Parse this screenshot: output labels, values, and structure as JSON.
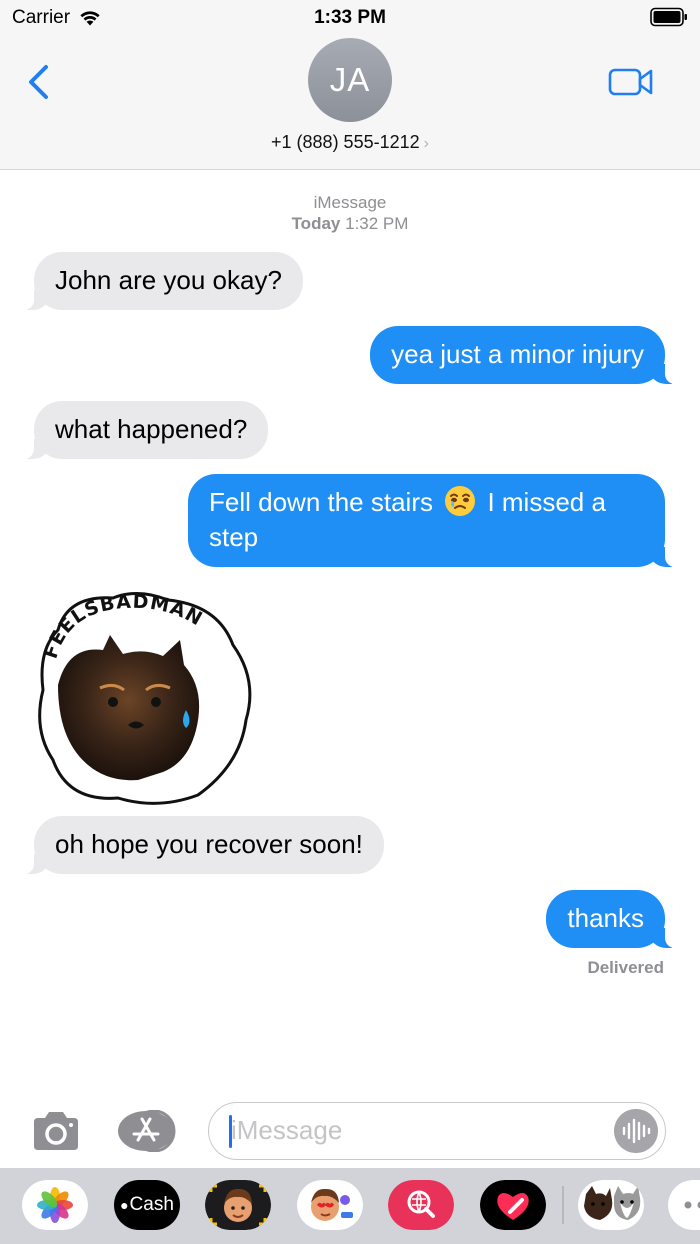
{
  "status_bar": {
    "carrier": "Carrier",
    "time": "1:33 PM"
  },
  "header": {
    "avatar_initials": "JA",
    "contact": "+1 (888) 555-1212",
    "chevron": "›"
  },
  "conversation": {
    "service": "iMessage",
    "timestamp_prefix": "Today",
    "timestamp_time": "1:32 PM",
    "messages": [
      {
        "from": "them",
        "text": "John are you okay?"
      },
      {
        "from": "me",
        "text": "yea just a minor injury"
      },
      {
        "from": "them",
        "text": "what happened?"
      },
      {
        "from": "me",
        "text_before": "Fell down the stairs",
        "emoji": "face-holding-back-tears-emoji",
        "text_after": "I missed a step"
      },
      {
        "from": "them",
        "type": "sticker",
        "sticker_text": "FEELSBADMAN",
        "icon": "sad-dog-sticker"
      },
      {
        "from": "them",
        "text": "oh hope you recover soon!"
      },
      {
        "from": "me",
        "text": "thanks"
      }
    ],
    "delivery_status": "Delivered"
  },
  "input_bar": {
    "placeholder": "iMessage"
  },
  "app_drawer": {
    "apps": [
      {
        "name": "photos-app-icon"
      },
      {
        "name": "apple-cash-app-icon",
        "label": "Cash"
      },
      {
        "name": "memoji-app-icon"
      },
      {
        "name": "memoji-stickers-app-icon"
      },
      {
        "name": "images-search-app-icon"
      },
      {
        "name": "digital-touch-app-icon"
      },
      {
        "name": "dog-stickers-app-icon"
      },
      {
        "name": "more-apps-icon"
      }
    ]
  },
  "colors": {
    "accent": "#1f8ef5",
    "received_bubble": "#e9e9eb",
    "secondary_text": "#8e8e93"
  }
}
